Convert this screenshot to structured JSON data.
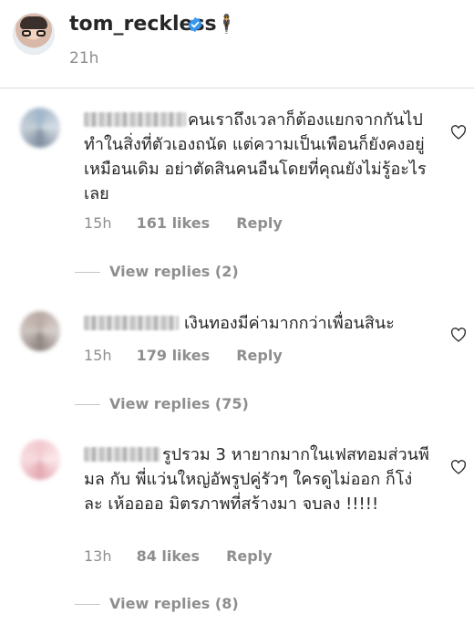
{
  "post": {
    "username": "tom_reckless",
    "time": "21h",
    "icons": {
      "verified": "verified-badge-icon",
      "figure": "figure-emoji-icon",
      "figure_glyph": "🕴"
    }
  },
  "comments": [
    {
      "text": "คนเราถึงเวลาก็ต้องแยกจากกันไปทำในสิ่งที่ตัวเองถนัด แต่ความเป็นเพือนก็ยังคงอยู่เหมือนเดิม  อย่าตัดสินคนอืนโดยที่คุณยังไม่รู้อะไรเลย",
      "time": "15h",
      "likes": "161 likes",
      "reply": "Reply",
      "view_replies": "View replies (2)"
    },
    {
      "text": "เงินทองมีค่ามากกว่าเพื่อนสินะ",
      "time": "15h",
      "likes": "179 likes",
      "reply": "Reply",
      "view_replies": "View replies (75)"
    },
    {
      "text": "รูปรวม 3 หายากมากในเฟสทอมส่วนพีมล กับ  พี่แว่นใหญ่อัพรูปคู่รัวๆ  ใครดูไม่ออก ก็โง่ละ เห้ออออ มิตรภาพที่สร้างมา จบลง !!!!!",
      "time": "13h",
      "likes": "84 likes",
      "reply": "Reply",
      "view_replies": "View replies (8)"
    }
  ],
  "colors": {
    "text": "#262626",
    "muted": "#8e8e8e",
    "verified": "#3897f0",
    "divider": "#dbdbdb"
  }
}
